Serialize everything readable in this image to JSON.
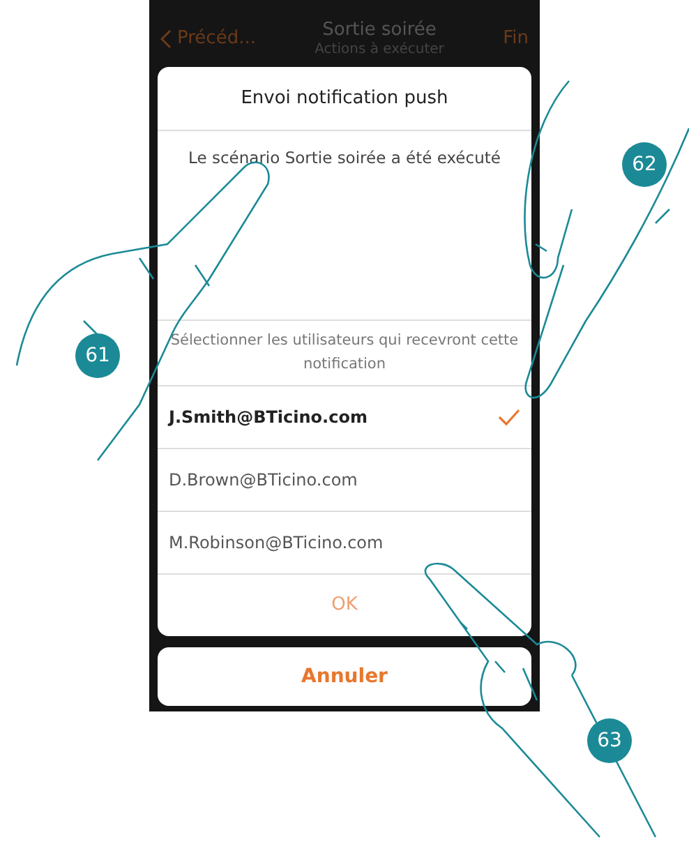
{
  "header": {
    "back": "Précéd...",
    "title": "Sortie soirée",
    "subtitle": "Actions à exécuter",
    "done": "Fin"
  },
  "dialog": {
    "title": "Envoi notification push",
    "message": "Le scénario Sortie soirée a été exécuté",
    "instruction": "Sélectionner les utilisateurs qui recevront cette notification",
    "users": [
      {
        "email": "J.Smith@BTicino.com",
        "selected": true
      },
      {
        "email": "D.Brown@BTicino.com",
        "selected": false
      },
      {
        "email": "M.Robinson@BTicino.com",
        "selected": false
      }
    ],
    "ok": "OK"
  },
  "cancel": "Annuler",
  "callouts": [
    "61",
    "62",
    "63"
  ]
}
